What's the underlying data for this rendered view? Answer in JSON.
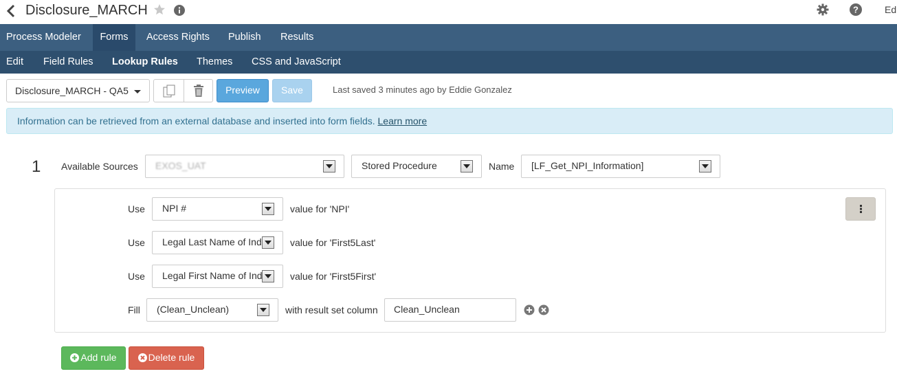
{
  "header": {
    "title": "Disclosure_MARCH",
    "user": "Ed"
  },
  "nav": {
    "primary": [
      "Process Modeler",
      "Forms",
      "Access Rights",
      "Publish",
      "Results"
    ],
    "secondary": [
      "Edit",
      "Field Rules",
      "Lookup Rules",
      "Themes",
      "CSS and JavaScript"
    ]
  },
  "toolbar": {
    "form_select": "Disclosure_MARCH - QA5",
    "preview_label": "Preview",
    "save_label": "Save",
    "last_saved": "Last saved 3 minutes ago by Eddie Gonzalez"
  },
  "alert": {
    "text": "Information can be retrieved from an external database and inserted into form fields.",
    "link": "Learn more"
  },
  "rule": {
    "number": "1",
    "available_sources_label": "Available Sources",
    "source_value": "EXOS_UAT",
    "source_type": "Stored Procedure",
    "name_label": "Name",
    "name_value": "[LF_Get_NPI_Information]",
    "use_label": "Use",
    "fill_label": "Fill",
    "mappings": [
      {
        "field": "NPI #",
        "suffix": "value for 'NPI'"
      },
      {
        "field": "Legal Last Name of Ind",
        "suffix": "value for 'First5Last'"
      },
      {
        "field": "Legal First Name of Ind",
        "suffix": "value for 'First5First'"
      }
    ],
    "fill": {
      "field": "(Clean_Unclean)",
      "with_label": "with result set column",
      "column": "Clean_Unclean"
    }
  },
  "actions": {
    "add_rule": "Add rule",
    "delete_rule": "Delete rule"
  },
  "colors": {
    "nav_primary": "#3c5f80",
    "nav_secondary": "#2e4f6e",
    "preview": "#5aa7dd",
    "add_rule": "#5cb85c",
    "delete_rule": "#d9634f",
    "alert_bg": "#d9edf7"
  }
}
